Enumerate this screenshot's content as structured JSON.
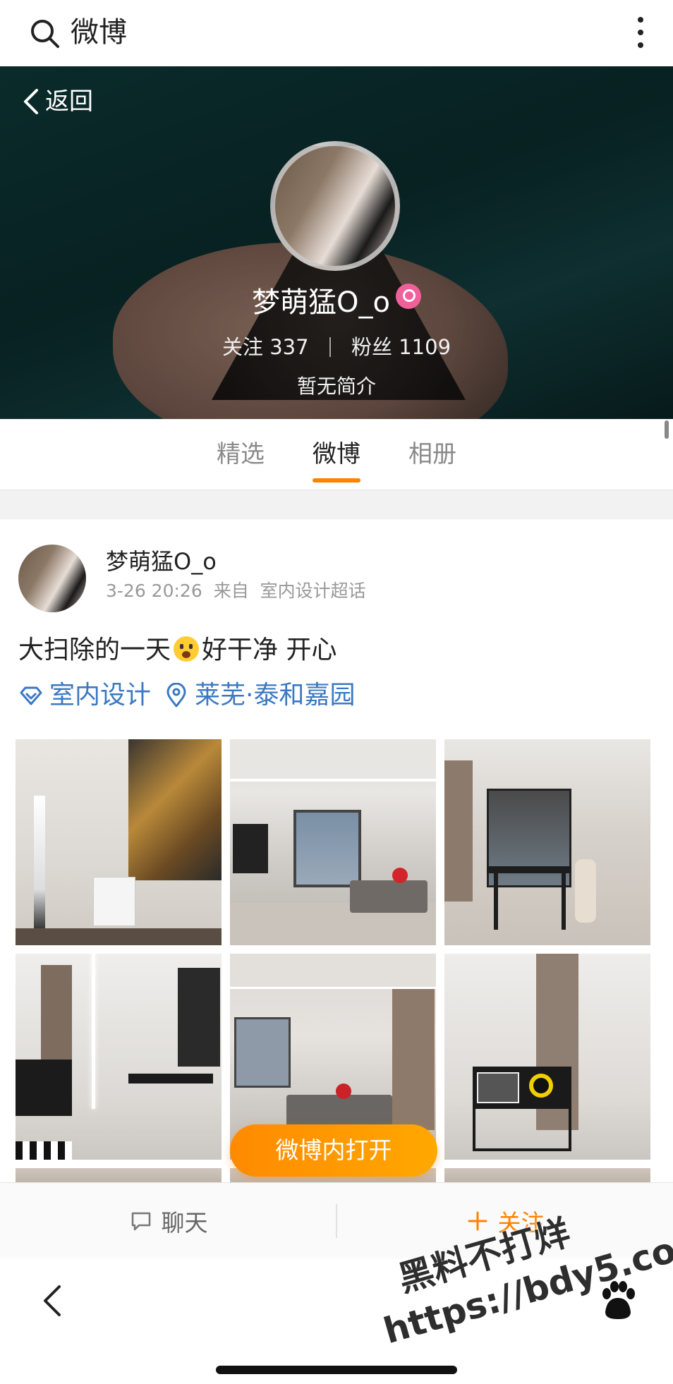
{
  "topbar": {
    "app_name": "微博"
  },
  "profile": {
    "back_label": "返回",
    "name": "梦萌猛O_o",
    "following_label": "关注",
    "following_count": "337",
    "followers_label": "粉丝",
    "followers_count": "1109",
    "bio": "暂无简介"
  },
  "tabs": [
    {
      "label": "精选",
      "active": false
    },
    {
      "label": "微博",
      "active": true
    },
    {
      "label": "相册",
      "active": false
    }
  ],
  "post": {
    "author": "梦萌猛O_o",
    "time": "3-26 20:26",
    "source_prefix": "来自",
    "source": "室内设计超话",
    "text_before": "大扫除的一天",
    "text_after": "好干净 开心",
    "emoji_icon": "scared-face-emoji",
    "topics": [
      {
        "icon": "diamond-icon",
        "label": "室内设计"
      },
      {
        "icon": "location-pin-icon",
        "label": "莱芜·泰和嘉园"
      }
    ],
    "photo_count": 9
  },
  "open_in_app_label": "微博内打开",
  "action_bar": {
    "chat_label": "聊天",
    "follow_label": "关注",
    "accent": "#ff8200"
  },
  "watermark": {
    "line1": "黑料不打烊",
    "line2": "https://bdy5.co"
  },
  "colors": {
    "accent_orange": "#ff8200",
    "link_blue": "#3a79c2",
    "badge_pink": "#f0609b"
  }
}
